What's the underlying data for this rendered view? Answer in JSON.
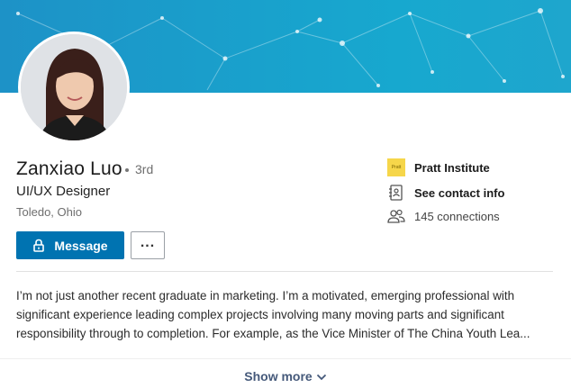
{
  "profile": {
    "name": "Zanxiao Luo",
    "degree": "3rd",
    "headline": "UI/UX Designer",
    "location": "Toledo, Ohio"
  },
  "actions": {
    "message_label": "Message",
    "more_label": "..."
  },
  "sidebar": {
    "school": "Pratt Institute",
    "school_logo_text": "Pratt",
    "contact": "See contact info",
    "connections": "145 connections"
  },
  "summary": {
    "text": "I’m not just another recent graduate in marketing. I’m a motivated, emerging professional with significant experience leading complex projects involving many moving parts and significant responsibility through to completion. For example, as the Vice Minister of The China Youth Lea...",
    "show_more_label": "Show more"
  },
  "colors": {
    "accent": "#0073b1",
    "banner": "#1a9fcb",
    "show_more": "#45597a"
  },
  "icons": [
    "lock-icon",
    "school-logo-icon",
    "contact-card-icon",
    "people-icon",
    "chevron-down-icon"
  ]
}
